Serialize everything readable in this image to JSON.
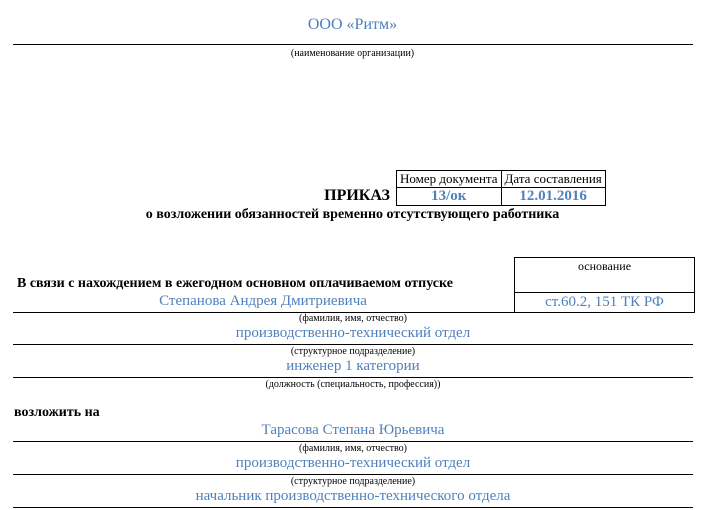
{
  "header": {
    "org_name": "ООО «Ритм»",
    "org_caption": "(наименование организации)"
  },
  "doc": {
    "number_label": "Номер документа",
    "date_label": "Дата составления",
    "number": "13/ок",
    "date": "12.01.2016",
    "title": "ПРИКАЗ",
    "subject": "о возложении обязанностей временно отсутствующего работника"
  },
  "reason": {
    "text": "В связи с нахождением в ежегодном основном оплачиваемом отпуске",
    "basis_label": "основание",
    "basis_value": "ст.60.2, 151 ТК РФ"
  },
  "absent": {
    "name": "Степанова Андрея Дмитриевича",
    "name_caption": "(фамилия, имя, отчество)",
    "department": "производственно-технический отдел",
    "department_caption": "(структурное подразделение)",
    "position": "инженер 1 категории",
    "position_caption": "(должность (специальность, профессия))"
  },
  "assign": {
    "label": "возложить на",
    "name": "Тарасова Степана Юрьевича",
    "name_caption": "(фамилия, имя, отчество)",
    "department": "производственно-технический отдел",
    "department_caption": "(структурное подразделение)",
    "position": "начальник производственно-технического отдела"
  }
}
